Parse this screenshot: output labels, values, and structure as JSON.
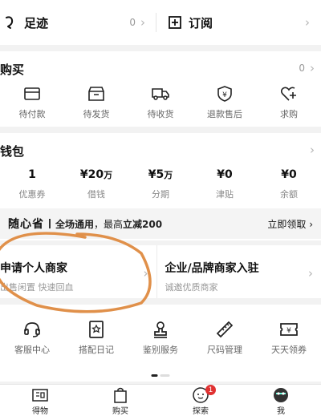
{
  "top": {
    "left": {
      "label": "足迹",
      "count": "0"
    },
    "right": {
      "label": "订阅"
    }
  },
  "orders": {
    "title": "购买",
    "count": "0",
    "items": [
      {
        "label": "待付款",
        "icon": "wallet-card-icon"
      },
      {
        "label": "待发货",
        "icon": "package-box-icon"
      },
      {
        "label": "待收货",
        "icon": "truck-icon"
      },
      {
        "label": "退款售后",
        "icon": "shield-yen-icon"
      },
      {
        "label": "求购",
        "icon": "heart-plus-icon"
      }
    ]
  },
  "wallet": {
    "title": "钱包",
    "items": [
      {
        "value": "1",
        "unit": "",
        "label": "优惠券"
      },
      {
        "value": "¥20",
        "unit": "万",
        "label": "借钱"
      },
      {
        "value": "¥5",
        "unit": "万",
        "label": "分期"
      },
      {
        "value": "¥0",
        "unit": "",
        "label": "津贴"
      },
      {
        "value": "¥0",
        "unit": "",
        "label": "余额"
      }
    ],
    "promo": {
      "brand": "随心省",
      "text_bold": "全场通用",
      "text_rest": "，最高",
      "text_bold2": "立减200",
      "cta": "立即领取"
    }
  },
  "merchant": {
    "left": {
      "title": "申请个人商家",
      "subtitle": "出售闲置 快速回血"
    },
    "right": {
      "title": "企业/品牌商家入驻",
      "subtitle": "诚邀优质商家"
    }
  },
  "services": {
    "items": [
      {
        "label": "客服中心",
        "icon": "headset-icon"
      },
      {
        "label": "搭配日记",
        "icon": "diary-book-icon"
      },
      {
        "label": "鉴别服务",
        "icon": "stamp-icon"
      },
      {
        "label": "尺码管理",
        "icon": "ruler-icon"
      },
      {
        "label": "天天领券",
        "icon": "coupon-icon"
      }
    ]
  },
  "tabbar": {
    "items": [
      {
        "label": "得物",
        "icon": "dewu-logo-icon"
      },
      {
        "label": "购买",
        "icon": "shopping-bag-icon"
      },
      {
        "label": "探索",
        "icon": "explore-face-icon",
        "badge": "1"
      },
      {
        "label": "我",
        "icon": "avatar-icon"
      }
    ]
  },
  "colors": {
    "annotation": "#e0904a",
    "badge": "#e03131"
  }
}
